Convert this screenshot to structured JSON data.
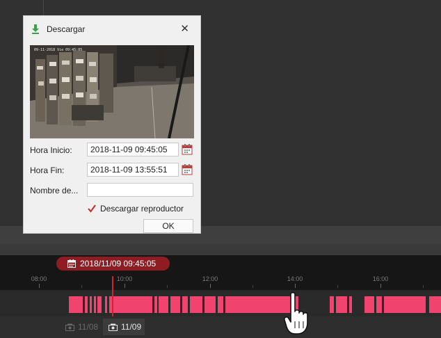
{
  "dialog": {
    "title": "Descargar",
    "start_label": "Hora Inicio:",
    "start_value": "2018-11-09 09:45:05",
    "end_label": "Hora Fin:",
    "end_value": "2018-11-09 13:55:51",
    "name_label": "Nombre de...",
    "name_value": "",
    "checkbox_label": "Descargar reproductor",
    "checkbox_checked": true,
    "ok_label": "OK"
  },
  "timeline": {
    "current_time": "2018/11/09 09:45:05",
    "ticks": [
      "08:00",
      "10:00",
      "12:00",
      "14:00",
      "16:00"
    ],
    "day_tabs": [
      "11/08",
      "11/09"
    ],
    "active_day": "11/09"
  },
  "colors": {
    "accent": "#d4232c",
    "recording": "#f0436d",
    "badge": "#8e1c22"
  }
}
